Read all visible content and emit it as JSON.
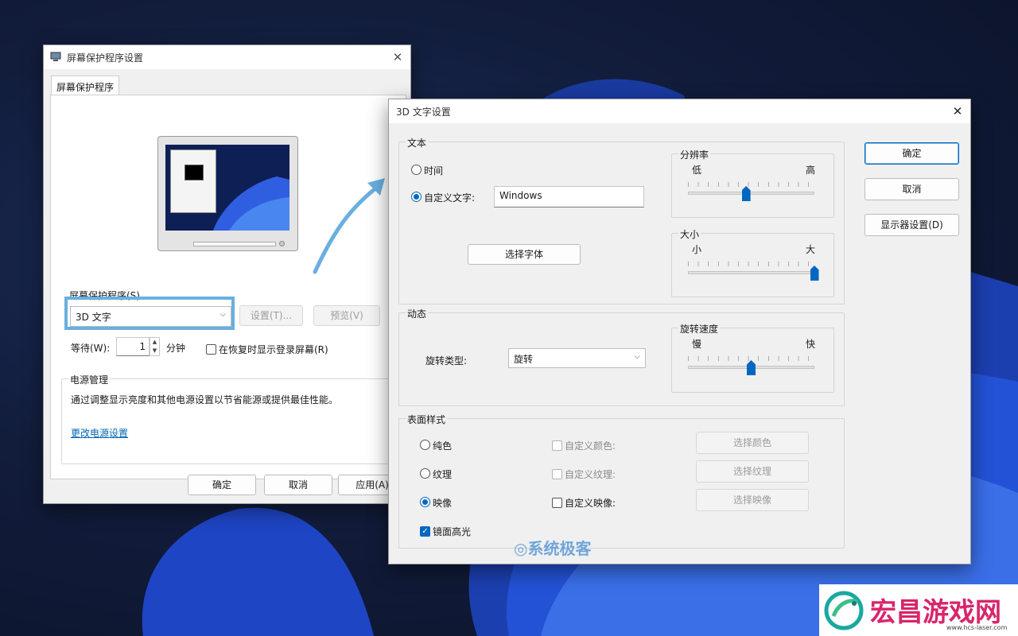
{
  "screensaver_window": {
    "title": "屏幕保护程序设置",
    "tab": "屏幕保护程序",
    "screensaver_label": "屏幕保护程序(S)",
    "selected_screensaver": "3D 文字",
    "settings_button": "设置(T)...",
    "preview_button": "预览(V)",
    "wait_label": "等待(W):",
    "wait_value": "1",
    "minutes_label": "分钟",
    "resume_checkbox_label": "在恢复时显示登录屏幕(R)",
    "resume_checked": false,
    "power_group": "电源管理",
    "power_description": "通过调整显示亮度和其他电源设置以节省能源或提供最佳性能。",
    "power_link": "更改电源设置",
    "ok_button": "确定",
    "cancel_button": "取消",
    "apply_button": "应用(A)"
  },
  "text3d_window": {
    "title": "3D 文字设置",
    "text_group": "文本",
    "time_option": "时间",
    "custom_text_option": "自定义文字:",
    "selected_text_option": "custom",
    "custom_text_value": "Windows",
    "choose_font_button": "选择字体",
    "resolution_group": "分辨率",
    "resolution_low": "低",
    "resolution_high": "高",
    "resolution_level": 0.46,
    "size_group": "大小",
    "size_small": "小",
    "size_large": "大",
    "size_level": 1.0,
    "motion_group": "动态",
    "rotation_type_label": "旋转类型:",
    "rotation_type_value": "旋转",
    "rotation_speed_group": "旋转速度",
    "speed_slow": "慢",
    "speed_fast": "快",
    "rotation_speed_level": 0.5,
    "surface_group": "表面样式",
    "solid_option": "纯色",
    "texture_option": "纹理",
    "reflection_option": "映像",
    "selected_surface": "reflection",
    "custom_color_label": "自定义颜色:",
    "custom_texture_label": "自定义纹理:",
    "custom_reflection_label": "自定义映像:",
    "choose_color_button": "选择颜色",
    "choose_texture_button": "选择纹理",
    "choose_reflection_button": "选择映像",
    "specular_label": "镜面高光",
    "specular_checked": true,
    "ok_button": "确定",
    "cancel_button": "取消",
    "display_settings_button": "显示器设置(D)"
  },
  "watermark": "系统极客",
  "brand": {
    "name": "宏昌游戏网",
    "url": "www.hcs-laser.com"
  },
  "colors": {
    "accent": "#0067c0",
    "highlight_box": "#6aafe0",
    "brand_pink": "#d8256b"
  }
}
